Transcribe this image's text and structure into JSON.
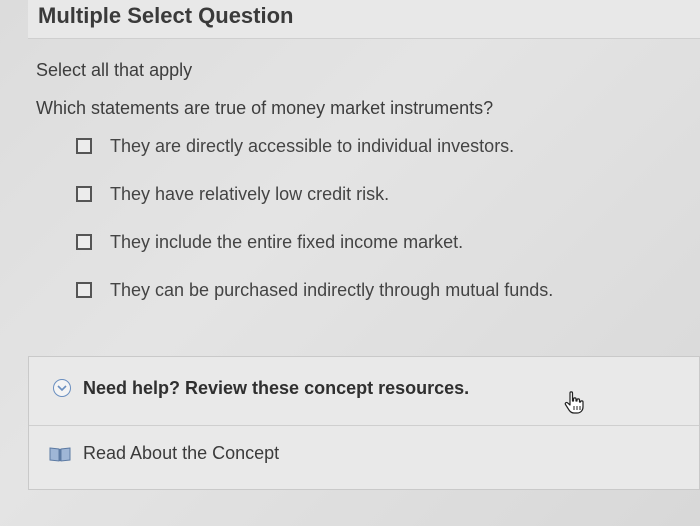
{
  "header": {
    "title": "Multiple Select Question"
  },
  "instruction": "Select all that apply",
  "question": "Which statements are true of money market instruments?",
  "options": [
    {
      "label": "They are directly accessible to individual investors.",
      "checked": false
    },
    {
      "label": "They have relatively low credit risk.",
      "checked": false
    },
    {
      "label": "They include the entire fixed income market.",
      "checked": false
    },
    {
      "label": "They can be purchased indirectly through mutual funds.",
      "checked": false
    }
  ],
  "help": {
    "title": "Need help? Review these concept resources.",
    "toggle_icon": "chevron-down-circle-icon",
    "resource_label": "Read About the Concept",
    "resource_icon": "book-icon"
  },
  "colors": {
    "accent": "#6a8fc0"
  }
}
